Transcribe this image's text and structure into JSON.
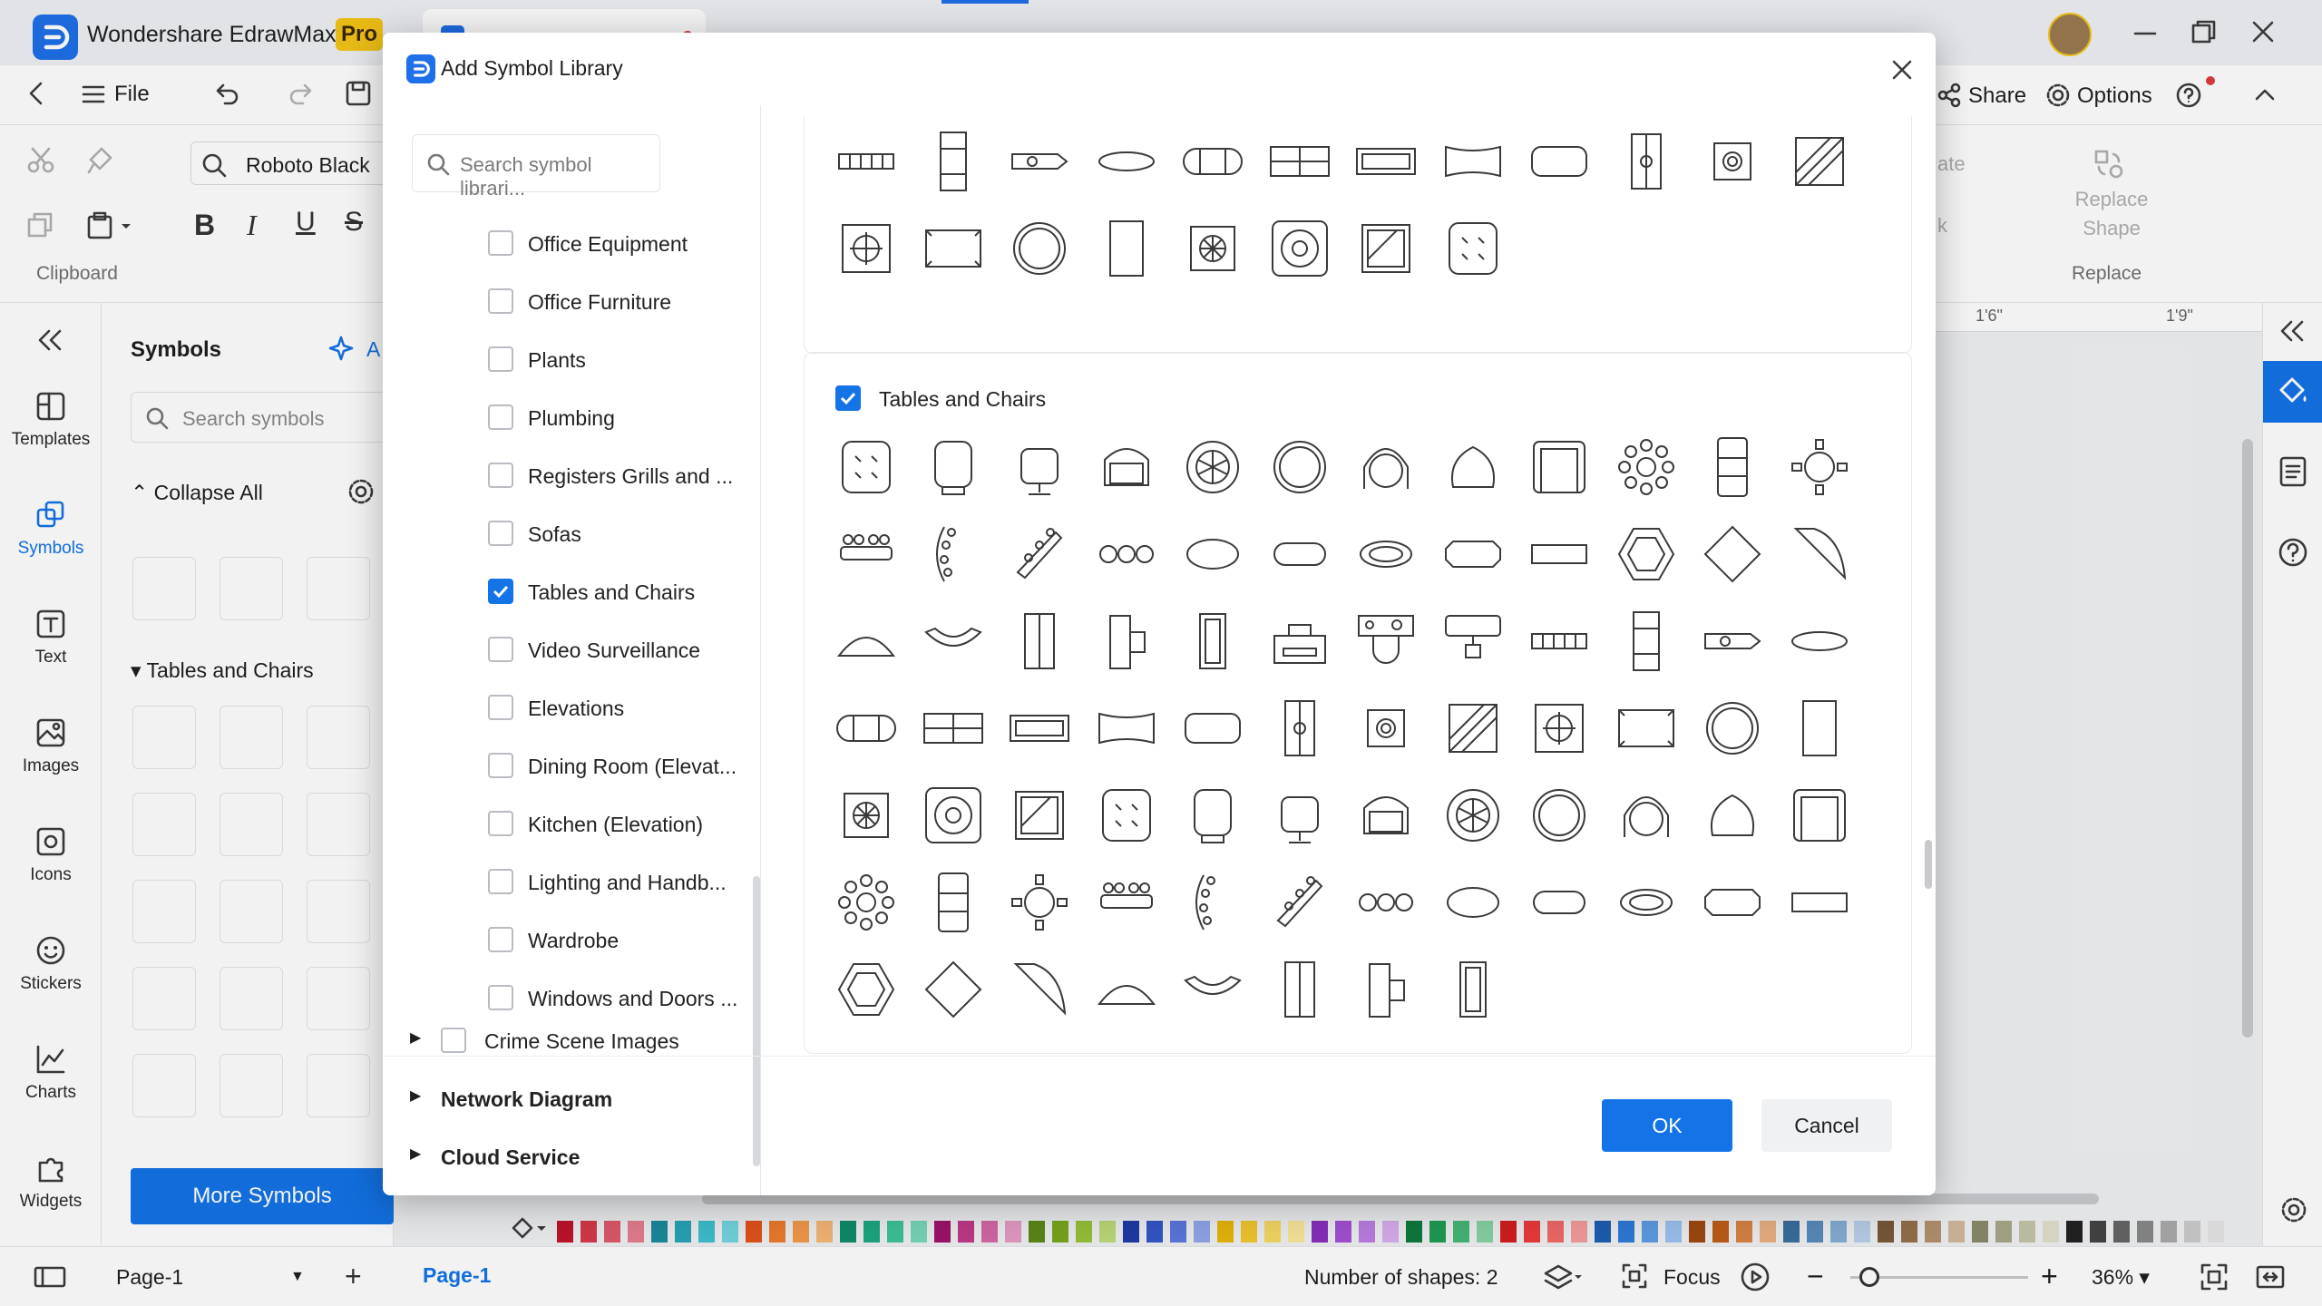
{
  "app": {
    "title": "Wondershare EdrawMax",
    "badge": "Pro",
    "tab_title": "..."
  },
  "toolbar": {
    "file_label": "File",
    "share_label": "Share",
    "options_label": "Options"
  },
  "ribbon": {
    "font_name": "Roboto Black",
    "clipboard_label": "Clipboard",
    "replace_shape_label": "Replace Shape",
    "replace_group_label": "Replace",
    "rotate_label": "ate",
    "lock_label": "k"
  },
  "left_rail": [
    {
      "label": "Templates",
      "icon": "templates-icon"
    },
    {
      "label": "Symbols",
      "icon": "symbols-icon"
    },
    {
      "label": "Text",
      "icon": "text-icon"
    },
    {
      "label": "Images",
      "icon": "images-icon"
    },
    {
      "label": "Icons",
      "icon": "icons-icon"
    },
    {
      "label": "Stickers",
      "icon": "stickers-icon"
    },
    {
      "label": "Charts",
      "icon": "charts-icon"
    },
    {
      "label": "Widgets",
      "icon": "widgets-icon"
    }
  ],
  "symbols_panel": {
    "title": "Symbols",
    "ai_label": "A",
    "search_placeholder": "Search symbols",
    "collapse_all": "Collapse All",
    "section_title": "Tables and Chairs",
    "more_symbols": "More Symbols"
  },
  "ruler": {
    "mark1": "1'6\"",
    "mark2": "1'9\""
  },
  "dialog": {
    "title": "Add Symbol Library",
    "search_placeholder": "Search symbol librari...",
    "library_items": [
      {
        "label": "Office Equipment",
        "checked": false
      },
      {
        "label": "Office Furniture",
        "checked": false
      },
      {
        "label": "Plants",
        "checked": false
      },
      {
        "label": "Plumbing",
        "checked": false
      },
      {
        "label": "Registers Grills and ...",
        "checked": false
      },
      {
        "label": "Sofas",
        "checked": false
      },
      {
        "label": "Tables and Chairs",
        "checked": true
      },
      {
        "label": "Video Surveillance",
        "checked": false
      },
      {
        "label": "Elevations",
        "checked": false
      },
      {
        "label": "Dining Room (Elevat...",
        "checked": false
      },
      {
        "label": "Kitchen (Elevation)",
        "checked": false
      },
      {
        "label": "Lighting and Handb...",
        "checked": false
      },
      {
        "label": "Wardrobe",
        "checked": false
      },
      {
        "label": "Windows and Doors ...",
        "checked": false
      }
    ],
    "crime_scene_label": "Crime Scene Images",
    "network_label": "Network Diagram",
    "cloud_label": "Cloud Service",
    "preview_section_label": "Tables and Chairs",
    "ok_label": "OK",
    "cancel_label": "Cancel"
  },
  "status": {
    "page_select": "Page-1",
    "page_tab": "Page-1",
    "shapes_count": "Number of shapes: 2",
    "focus_label": "Focus",
    "zoom": "36%"
  },
  "palette_colors": [
    "#c0152f",
    "#d63a4a",
    "#e05a6b",
    "#e77f8f",
    "#1c8c9e",
    "#27a6b8",
    "#3fc0cf",
    "#74d6df",
    "#e3541c",
    "#f07b2e",
    "#f59a4b",
    "#f8b878",
    "#0f8e6b",
    "#1caa82",
    "#3ec49b",
    "#7ad9bb",
    "#a0146b",
    "#c03a8a",
    "#d46aa6",
    "#e69cc4",
    "#5d8a1a",
    "#7aa81e",
    "#98c33a",
    "#bfdb7a",
    "#203ca8",
    "#3557c9",
    "#5b79de",
    "#92a7ec",
    "#e8b70c",
    "#f2c930",
    "#f7da62",
    "#fae89a",
    "#8a2fc0",
    "#a552d6",
    "#be7fe4",
    "#d8aff0",
    "#0e7c3e",
    "#1f9d55",
    "#47b878",
    "#88d4a5",
    "#d41f1f",
    "#ec3b3b",
    "#f26a6a",
    "#f79d9d",
    "#1e5fb4",
    "#2f7bd8",
    "#5e9de6",
    "#9cc3f1",
    "#a04a12",
    "#c05e1a",
    "#d98446",
    "#ebb183",
    "#3c6fa0",
    "#5a8dbf",
    "#86aed6",
    "#b9d1ea",
    "#7a5a3a",
    "#96714b",
    "#b49270",
    "#d2b89c",
    "#8a8a6a",
    "#a7a788",
    "#c4c4aa",
    "#e0e0cc",
    "#222222",
    "#444444",
    "#666666",
    "#888888",
    "#aaaaaa",
    "#cccccc",
    "#e5e5e5"
  ]
}
